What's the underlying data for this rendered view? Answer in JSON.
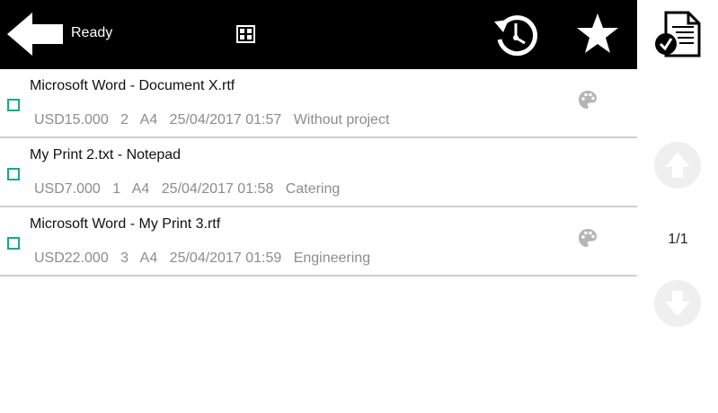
{
  "header": {
    "status": "Ready",
    "icons": {
      "back": "back-arrow-icon",
      "grid": "grid-view-icon",
      "history": "history-icon",
      "favorite": "star-icon",
      "jobs": "print-jobs-icon"
    }
  },
  "jobs": [
    {
      "name": "Microsoft Word - Document X.rtf",
      "price": "USD15.000",
      "copies": "2",
      "paper": "A4",
      "datetime": "25/04/2017 01:57",
      "project": "Without project",
      "color": true
    },
    {
      "name": "My Print 2.txt - Notepad",
      "price": "USD7.000",
      "copies": "1",
      "paper": "A4",
      "datetime": "25/04/2017 01:58",
      "project": "Catering",
      "color": false
    },
    {
      "name": "Microsoft Word - My Print 3.rtf",
      "price": "USD22.000",
      "copies": "3",
      "paper": "A4",
      "datetime": "25/04/2017 01:59",
      "project": "Engineering",
      "color": true
    }
  ],
  "pagination": {
    "label": "1/1"
  },
  "colors": {
    "accent": "#1fa58c",
    "bar": "#000000",
    "meta_text": "#8c8c8c",
    "disabled": "#efefef"
  }
}
